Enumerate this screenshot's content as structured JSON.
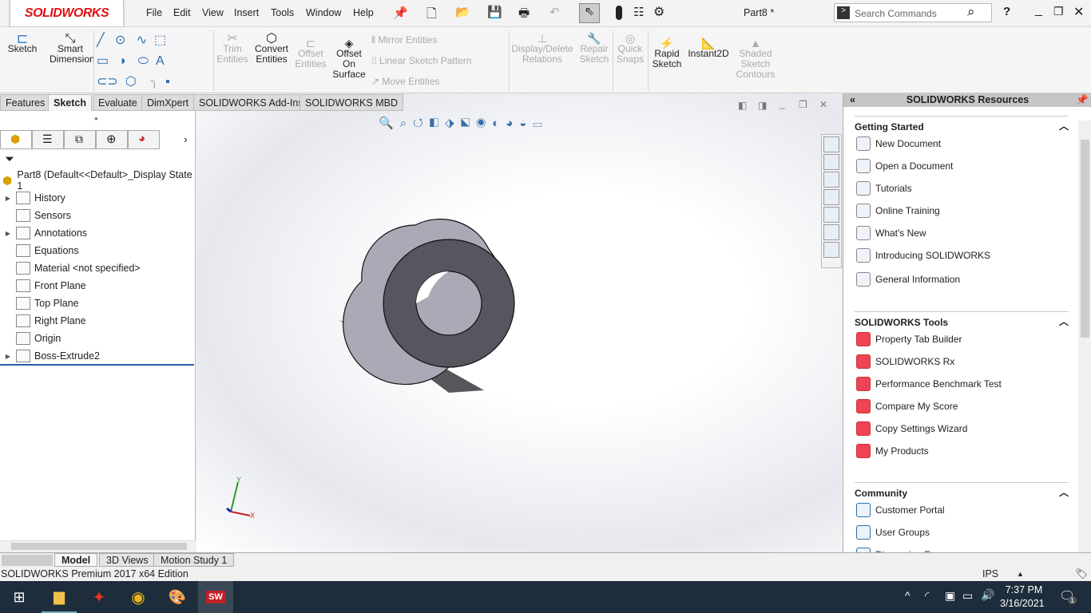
{
  "app": {
    "logo": "SOLIDWORKS",
    "title": "Part8 *",
    "search_placeholder": "Search Commands",
    "help": "?"
  },
  "menu": [
    "File",
    "Edit",
    "View",
    "Insert",
    "Tools",
    "Window",
    "Help"
  ],
  "ribbon": {
    "sketch": "Sketch",
    "smart_dimension": "Smart Dimension",
    "trim": "Trim Entities",
    "convert": "Convert Entities",
    "offset": "Offset Entities",
    "offset_surface": "Offset On Surface",
    "mirror": "Mirror Entities",
    "linear_pattern": "Linear Sketch Pattern",
    "move": "Move Entities",
    "display_delete": "Display/Delete Relations",
    "repair": "Repair Sketch",
    "quick_snaps": "Quick Snaps",
    "rapid": "Rapid Sketch",
    "instant2d": "Instant2D",
    "shaded": "Shaded Sketch Contours"
  },
  "tabs": [
    "Features",
    "Sketch",
    "Evaluate",
    "DimXpert",
    "SOLIDWORKS Add-Ins",
    "SOLIDWORKS MBD"
  ],
  "active_tab": "Sketch",
  "tree": {
    "root": "Part8  (Default<<Default>_Display State 1",
    "items": [
      {
        "label": "History",
        "expandable": true
      },
      {
        "label": "Sensors",
        "expandable": false
      },
      {
        "label": "Annotations",
        "expandable": true
      },
      {
        "label": "Equations",
        "expandable": false
      },
      {
        "label": "Material <not specified>",
        "expandable": false
      },
      {
        "label": "Front Plane",
        "expandable": false
      },
      {
        "label": "Top Plane",
        "expandable": false
      },
      {
        "label": "Right Plane",
        "expandable": false
      },
      {
        "label": "Origin",
        "expandable": false
      },
      {
        "label": "Boss-Extrude2",
        "expandable": true
      }
    ]
  },
  "triad": {
    "x": "X",
    "y": "Y"
  },
  "resources": {
    "title": "SOLIDWORKS Resources",
    "sections": [
      {
        "title": "Getting Started",
        "items": [
          "New Document",
          "Open a Document",
          "Tutorials",
          "Online Training",
          "What's New",
          "Introducing SOLIDWORKS",
          "General Information"
        ]
      },
      {
        "title": "SOLIDWORKS Tools",
        "items": [
          "Property Tab Builder",
          "SOLIDWORKS Rx",
          "Performance Benchmark Test",
          "Compare My Score",
          "Copy Settings Wizard",
          "My Products"
        ]
      },
      {
        "title": "Community",
        "items": [
          "Customer Portal",
          "User Groups",
          "Discussion Forum"
        ]
      }
    ]
  },
  "bottom_tabs": [
    "Model",
    "3D Views",
    "Motion Study 1"
  ],
  "status": {
    "edition": "SOLIDWORKS Premium 2017 x64 Edition",
    "units": "IPS"
  },
  "taskbar": {
    "time": "7:37 PM",
    "date": "3/16/2021",
    "notifications": "1"
  },
  "colors": {
    "brand": "#d6161e",
    "model_face": "#55565e",
    "model_side": "#a9aab6",
    "taskbar": "#1e2d3b"
  }
}
